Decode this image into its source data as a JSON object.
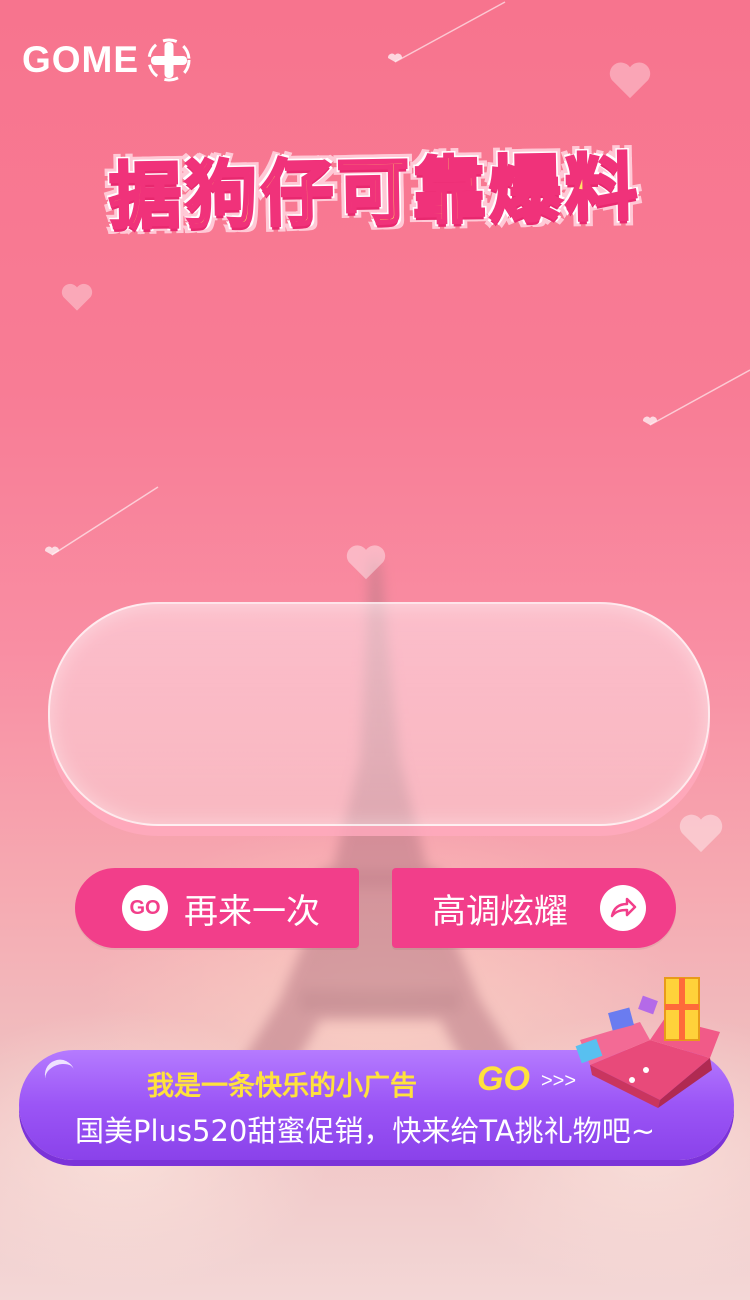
{
  "brand": {
    "logo_text": "GOME"
  },
  "title": "据狗仔可靠爆料",
  "result": {
    "text": ""
  },
  "buttons": {
    "retry_badge": "GO",
    "retry_label": "再来一次",
    "share_label": "高调炫耀"
  },
  "ad": {
    "line1": "我是一条快乐的小广告",
    "go": "GO",
    "arrows": ">>>",
    "line2": "国美Plus520甜蜜促销，快来给TA挑礼物吧~"
  },
  "colors": {
    "accent": "#f23e8a",
    "title_fill": "#ffe566",
    "ad_purple": "#9b55f6",
    "ad_yellow": "#ffe23c"
  },
  "icons": [
    "gome-plus-logo-icon",
    "go-badge-icon",
    "share-arrow-icon",
    "gift-box-icon",
    "heart-icon"
  ]
}
